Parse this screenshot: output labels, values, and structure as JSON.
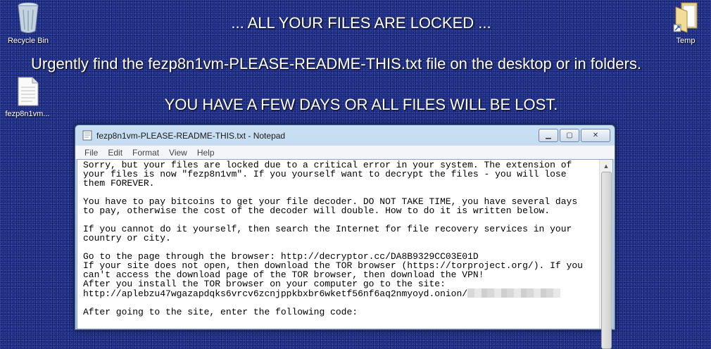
{
  "desktop": {
    "recycle_bin_label": "Recycle Bin",
    "temp_label": "Temp",
    "readme_file_label": "fezp8n1vm..."
  },
  "banner": {
    "line1": "... ALL YOUR FILES ARE LOCKED ...",
    "line2": "Urgently find the fezp8n1vm-PLEASE-README-THIS.txt file on the desktop or in folders.",
    "line3": "YOU HAVE A FEW DAYS OR ALL FILES WILL BE LOST."
  },
  "notepad": {
    "title": "fezp8n1vm-PLEASE-README-THIS.txt - Notepad",
    "menu": [
      "File",
      "Edit",
      "Format",
      "View",
      "Help"
    ],
    "lines": [
      "Sorry, but your files are locked due to a critical error in your system. The extension of",
      "your files is now \"fezp8n1vm\". If you yourself want to decrypt the files - you will lose",
      "them FOREVER.",
      "",
      "You have to pay bitcoins to get your file decoder. DO NOT TAKE TIME, you have several days",
      "to pay, otherwise the cost of the decoder will double. How to do it is written below.",
      "",
      "If you cannot do it yourself, then search the Internet for file recovery services in your",
      "country or city.",
      "",
      "Go to the page through the browser: http://decryptor.cc/DA8B9329CC03E01D",
      "If your site does not open, then download the TOR browser (https://torproject.org/). If you",
      "can't access the download page of the TOR browser, then download the VPN!",
      "After you install the TOR browser on your computer go to the site:"
    ],
    "onion_line": "http://aplebzu47wgazapdqks6vrcv6zcnjppkbxbr6wketf56nf6aq2nmyoyd.onion/",
    "after_lines": [
      "",
      "After going to the site, enter the following code:"
    ]
  }
}
